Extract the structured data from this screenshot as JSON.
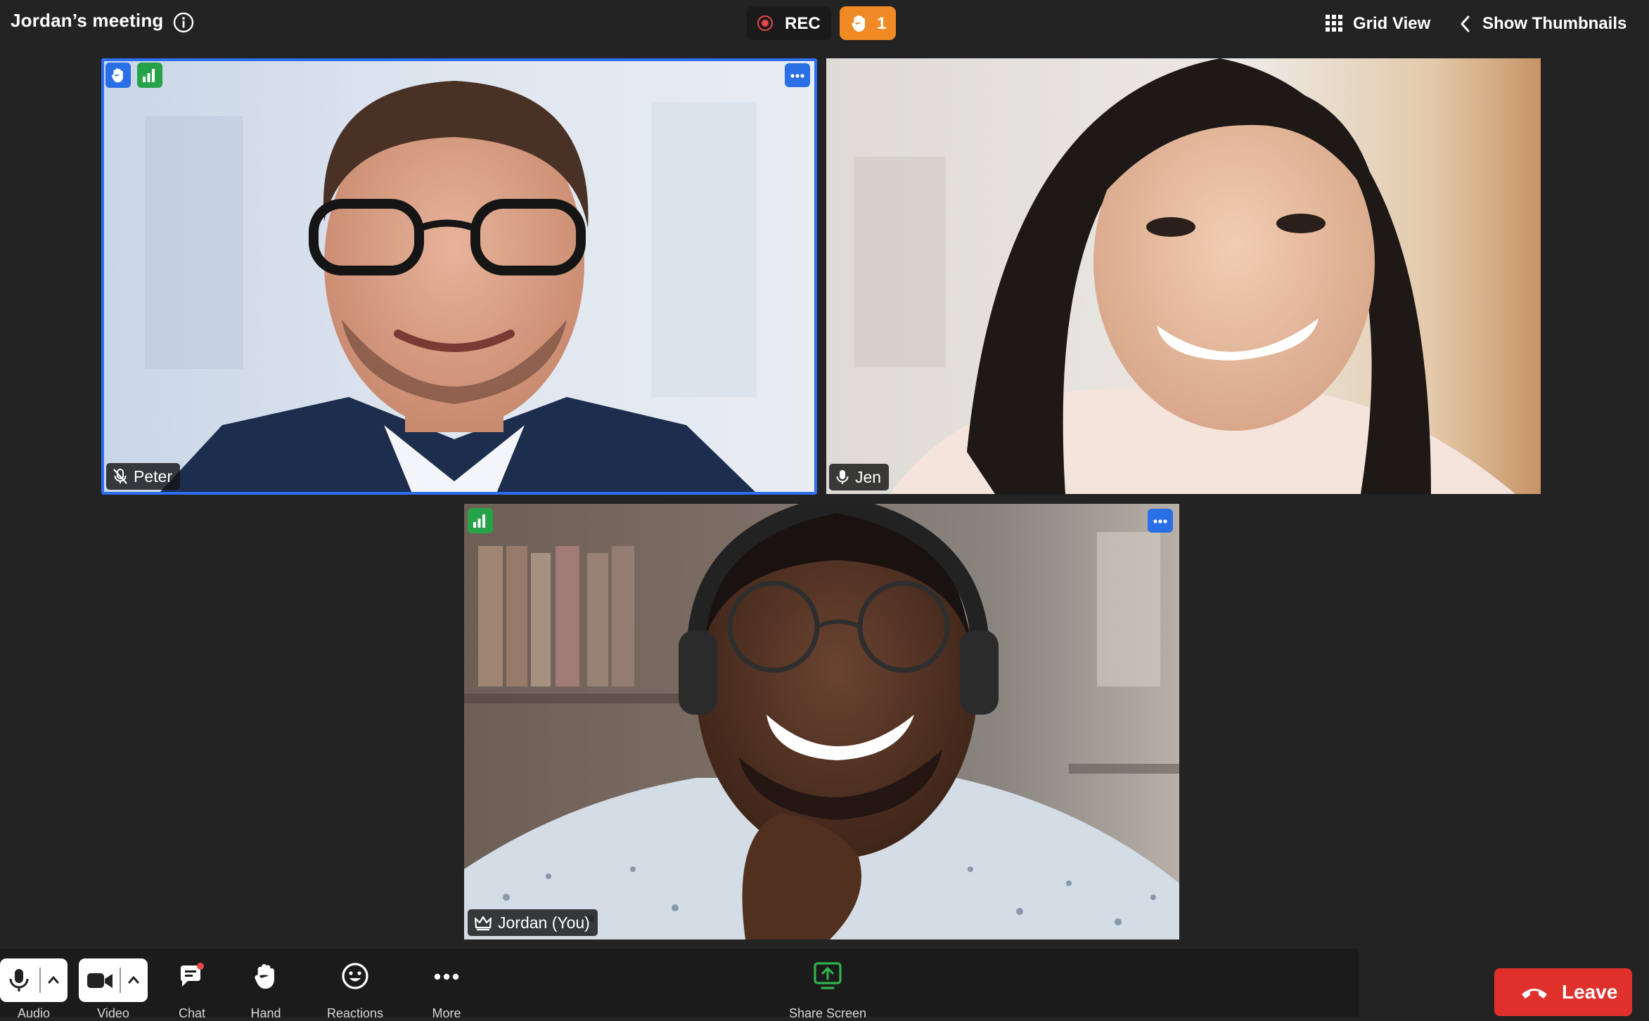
{
  "meeting": {
    "title": "Jordan’s meeting"
  },
  "recording": {
    "label": "REC"
  },
  "raised_hands": {
    "count": "1"
  },
  "view": {
    "grid_label": "Grid View",
    "thumbnails_label": "Show Thumbnails"
  },
  "participants": [
    {
      "name": "Peter",
      "muted": true,
      "hand_raised": true,
      "active_speaker": true
    },
    {
      "name": "Jen",
      "muted": false,
      "hand_raised": false
    },
    {
      "name": "Jordan (You)",
      "host": true,
      "muted": false
    }
  ],
  "toolbar": {
    "audio": "Audio",
    "video": "Video",
    "chat": "Chat",
    "hand": "Hand",
    "reactions": "Reactions",
    "more": "More",
    "share": "Share Screen",
    "leave": "Leave"
  },
  "colors": {
    "background": "#232323",
    "accent_blue": "#2b6fe6",
    "recording_red": "#e8474a",
    "hand_orange": "#f08a24",
    "signal_green": "#26a248",
    "leave_red": "#e0302b",
    "share_green": "#2fb34c"
  },
  "icons": {
    "info": "info-icon",
    "record": "record-dot-icon",
    "raise_hand": "hand-icon",
    "grid": "grid-icon",
    "chevron_left": "chevron-left-icon",
    "mic": "microphone-icon",
    "mic_muted": "microphone-muted-icon",
    "camera": "video-camera-icon",
    "chat": "chat-bubble-icon",
    "reactions": "smiley-icon",
    "more": "ellipsis-icon",
    "share": "share-screen-icon",
    "leave": "phone-hangup-icon",
    "host": "crown-icon",
    "signal": "signal-bars-icon"
  }
}
